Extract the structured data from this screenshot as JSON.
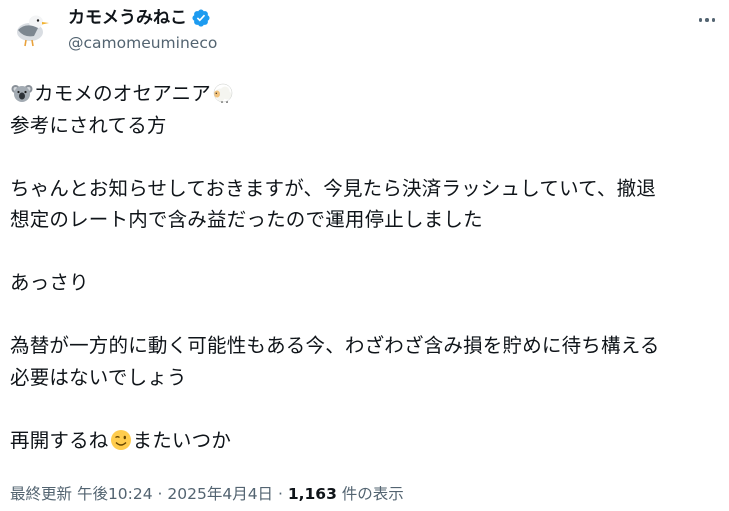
{
  "author": {
    "display_name": "カモメうみねこ",
    "handle": "@camomeumineco",
    "verified": true,
    "avatar_icon": "seagull-avatar-icon"
  },
  "tweet": {
    "line1_text": "カモメのオセアニア",
    "line1_emoji_start": "koala-emoji",
    "line1_emoji_end": "sheep-emoji",
    "line2": "参考にされてる方",
    "line3": "ちゃんとお知らせしておきますが、今見たら決済ラッシュしていて、撤退",
    "line4": "想定のレート内で含み益だったので運用停止しました",
    "line5": "あっさり",
    "line6": "為替が一方的に動く可能性もある今、わざわざ含み損を貯めに待ち構える",
    "line7": "必要はないでしょう",
    "line8_part1": "再開するね",
    "line8_emoji": "winking-face-emoji",
    "line8_part2": "またいつか"
  },
  "meta": {
    "prefix": "最終更新 ",
    "time": "午後10:24",
    "sep": " · ",
    "date": "2025年4月4日",
    "sep2": " · ",
    "views_count": "1,163",
    "views_label": " 件の表示"
  },
  "colors": {
    "text": "#0f1419",
    "secondary": "#536471",
    "verified_blue": "#1d9bf0"
  }
}
